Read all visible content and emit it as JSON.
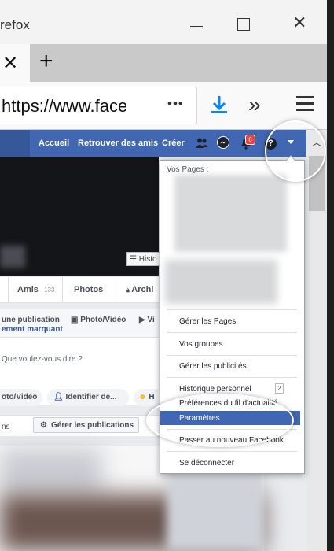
{
  "window": {
    "title": "refox"
  },
  "toolbar": {
    "url": "https://www.faceb",
    "more_label": "•••"
  },
  "facebook_nav": {
    "links": [
      "Accueil",
      "Retrouver des amis",
      "Créer"
    ],
    "notification_count": "6",
    "help_label": "?"
  },
  "profile": {
    "history_button": "Histo",
    "tabs": [
      "Amis",
      "133",
      "Photos",
      "Archi"
    ],
    "composer_actions": [
      "une publication",
      "Photo/Vidéo",
      "Vi"
    ],
    "composer_sub": "ement marquant",
    "composer_prompt": "Que voulez-vous dire ?",
    "pills": [
      "oto/Vidéo",
      "Identifier de...",
      "H"
    ],
    "posts_bar_left": "ns",
    "manage_posts": "Gérer les publications"
  },
  "dropdown": {
    "header": "Vos Pages :",
    "items": [
      "Gérer les Pages",
      "Vos groupes",
      "Gérer les publicités",
      "Historique personnel",
      "Préférences du fil d'actualité",
      "Paramètres",
      "Passer au nouveau Facebook",
      "Se déconnecter"
    ],
    "history_count": "2",
    "selected_index": 5
  },
  "colors": {
    "facebook_blue": "#4267b2",
    "firefox_download": "#0a84ff"
  }
}
